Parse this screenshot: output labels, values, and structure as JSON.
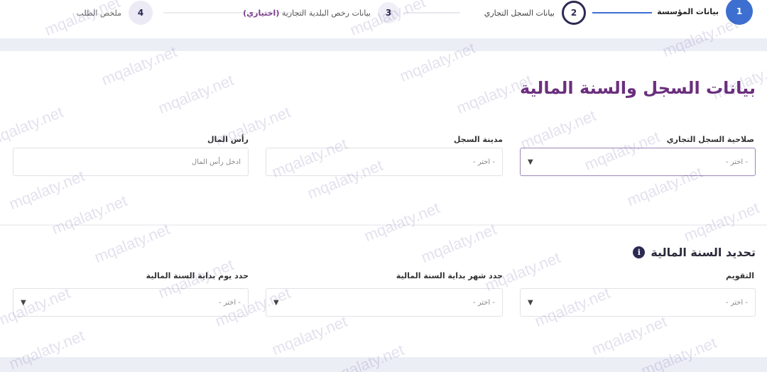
{
  "stepper": {
    "steps": [
      {
        "number": "1",
        "label": "بيانات المؤسسة"
      },
      {
        "number": "2",
        "label": "بيانات السجل التجاري"
      },
      {
        "number": "3",
        "label": "بيانات رخص البلدية التجارية",
        "optional": "(اختياري)"
      },
      {
        "number": "4",
        "label": "ملخص الطلب"
      }
    ]
  },
  "registry_section": {
    "title": "بيانات السجل والسنة المالية",
    "fields": {
      "validity": {
        "label": "صلاحية السجل التجاري",
        "placeholder": "- اختر -"
      },
      "city": {
        "label": "مدينة السجل",
        "placeholder": "- اختر -"
      },
      "capital": {
        "label": "رأس المال",
        "placeholder": "ادخل رأس المال"
      }
    }
  },
  "fiscal_section": {
    "title": "تحديد السنة المالية",
    "info_icon": "i",
    "fields": {
      "calendar": {
        "label": "التقويم",
        "placeholder": "- اختر -"
      },
      "month": {
        "label": "حدد شهر بداية السنة المالية",
        "placeholder": "- اختر -"
      },
      "day": {
        "label": "حدد يوم بداية السنة المالية",
        "placeholder": "- اختر -"
      }
    }
  },
  "icons": {
    "dropdown": "chevron-down-icon",
    "info": "info-icon"
  },
  "colors": {
    "accent": "#6b2f7d",
    "active_step": "#3d6fd1",
    "navy": "#2c2a52"
  },
  "watermark": "mqalaty.net"
}
